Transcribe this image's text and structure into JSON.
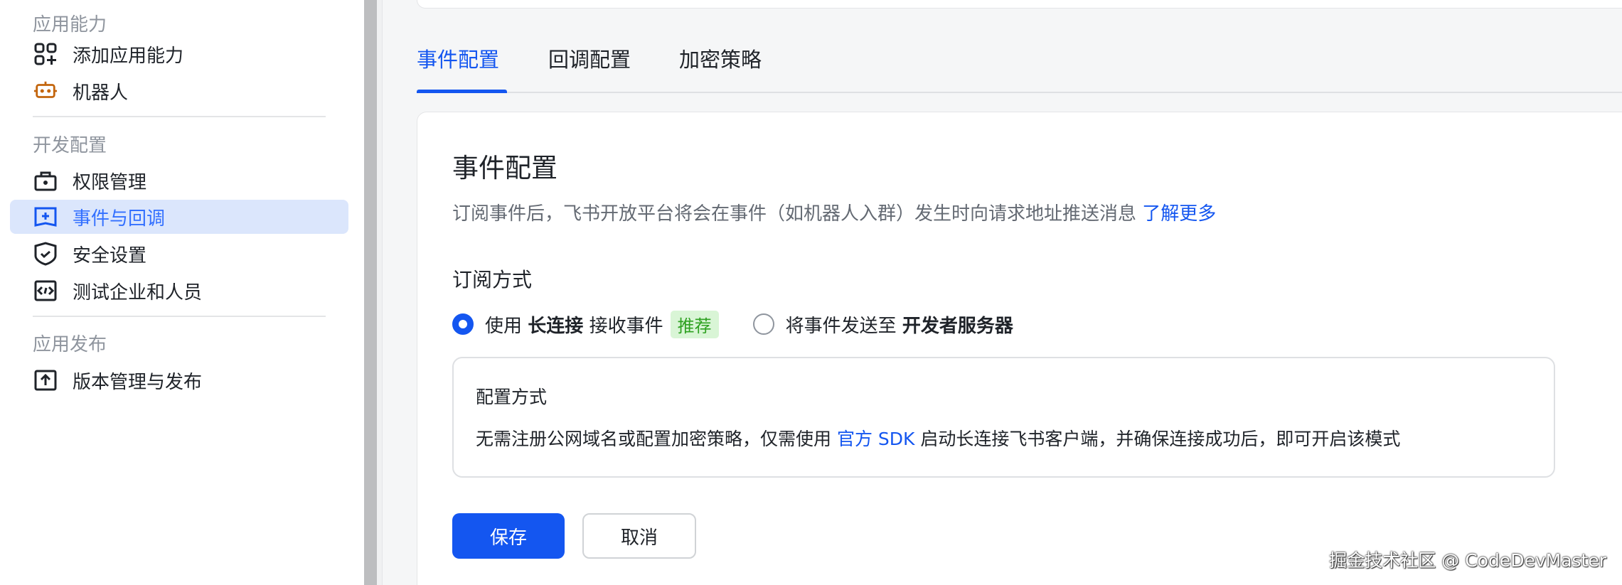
{
  "sidebar": {
    "sections": [
      {
        "title": "应用能力",
        "items": [
          {
            "label": "添加应用能力",
            "icon": "add-capability-icon"
          },
          {
            "label": "机器人",
            "icon": "robot-icon"
          }
        ]
      },
      {
        "title": "开发配置",
        "items": [
          {
            "label": "权限管理",
            "icon": "permission-icon"
          },
          {
            "label": "事件与回调",
            "icon": "event-callback-icon",
            "active": true
          },
          {
            "label": "安全设置",
            "icon": "shield-check-icon"
          },
          {
            "label": "测试企业和人员",
            "icon": "code-icon"
          }
        ]
      },
      {
        "title": "应用发布",
        "items": [
          {
            "label": "版本管理与发布",
            "icon": "upload-icon"
          }
        ]
      }
    ]
  },
  "tabs": [
    {
      "label": "事件配置",
      "active": true
    },
    {
      "label": "回调配置"
    },
    {
      "label": "加密策略"
    }
  ],
  "main": {
    "title": "事件配置",
    "description": "订阅事件后，飞书开放平台将会在事件（如机器人入群）发生时向请求地址推送消息",
    "learn_more": "了解更多",
    "subscription_label": "订阅方式",
    "option1": {
      "prefix": "使用",
      "bold": "长连接",
      "suffix": "接收事件",
      "badge": "推荐",
      "selected": true
    },
    "option2": {
      "prefix": "将事件发送至",
      "bold": "开发者服务器",
      "selected": false
    },
    "config_box": {
      "title": "配置方式",
      "text_before": "无需注册公网域名或配置加密策略，仅需使用",
      "link": "官方 SDK",
      "text_after": "启动长连接飞书客户端，并确保连接成功后，即可开启该模式"
    },
    "save_label": "保存",
    "cancel_label": "取消"
  },
  "watermark": "掘金技术社区 @ CodeDevMaster",
  "colors": {
    "accent": "#1456f0",
    "badge_bg": "#d9f5d6",
    "badge_text": "#2ea121",
    "active_item_bg": "#dbe6fc"
  }
}
